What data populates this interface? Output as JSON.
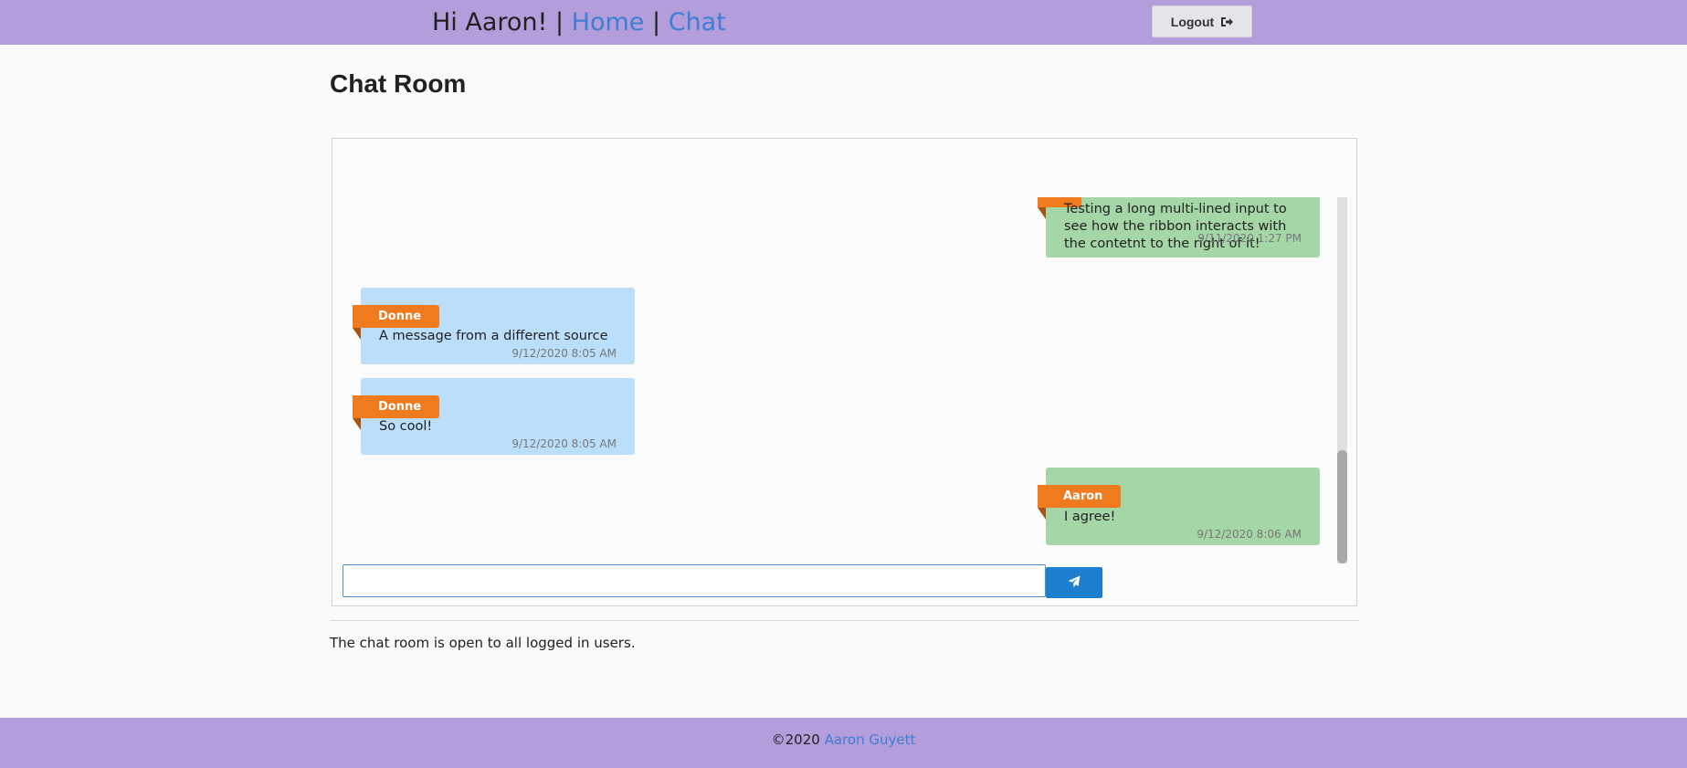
{
  "header": {
    "greeting": "Hi Aaron!",
    "separator": "|",
    "nav_home": "Home",
    "nav_chat": "Chat",
    "logout_label": "Logout",
    "logout_icon": "sign-out-icon",
    "background_color": "#b39ddb",
    "link_color": "#3d7fd4"
  },
  "page": {
    "title": "Chat Room",
    "footnote": "The chat room is open to all logged in users."
  },
  "messages": [
    {
      "author": "",
      "text": "Testing a long multi-lined input to see how the ribbon interacts with the contetnt to the right of it!",
      "time": "9/11/2020 1:27 PM",
      "side": "outgoing"
    },
    {
      "author": "Donne",
      "text": "A message from a different source",
      "time": "9/12/2020 8:05 AM",
      "side": "incoming"
    },
    {
      "author": "Donne",
      "text": "So cool!",
      "time": "9/12/2020 8:05 AM",
      "side": "incoming"
    },
    {
      "author": "Aaron",
      "text": "I agree!",
      "time": "9/12/2020 8:06 AM",
      "side": "outgoing"
    }
  ],
  "colors": {
    "incoming_bubble": "#bbdefb",
    "outgoing_bubble": "#a5d6a7",
    "ribbon": "#f07a1e",
    "send_button": "#1e7fd0"
  },
  "compose": {
    "value": "",
    "placeholder": "",
    "send_icon": "paper-plane-icon"
  },
  "footer": {
    "copyright": "©2020",
    "author_link": "Aaron Guyett"
  }
}
